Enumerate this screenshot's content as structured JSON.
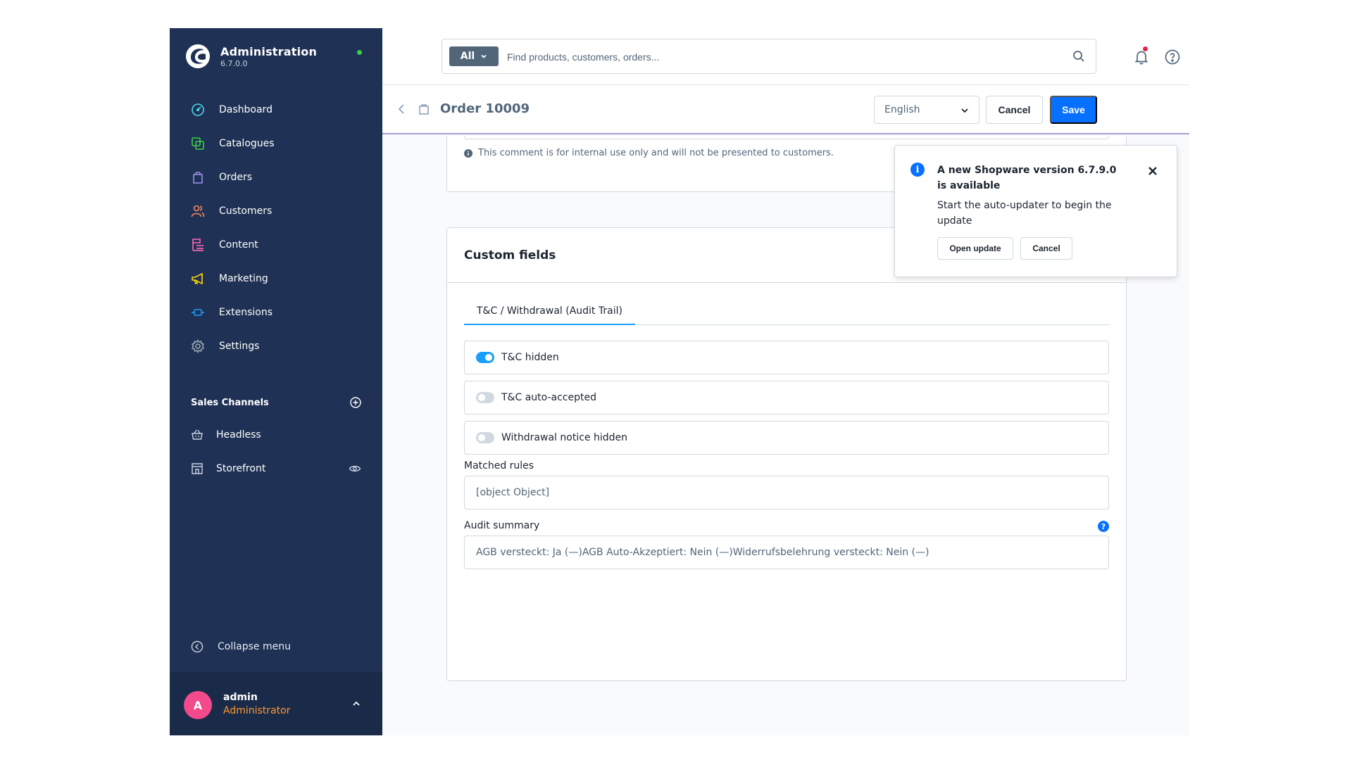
{
  "app": {
    "title": "Administration",
    "version": "6.7.0.0"
  },
  "colors": {
    "sidebar": "#1f3154",
    "primary": "#0870ff",
    "accent": "#189eff",
    "role": "#ff9a2f",
    "status_online": "#37d046"
  },
  "sidebar": {
    "items": [
      {
        "label": "Dashboard",
        "icon": "dashboard-icon",
        "color": "#4ed8e8"
      },
      {
        "label": "Catalogues",
        "icon": "catalogue-icon",
        "color": "#37d046"
      },
      {
        "label": "Orders",
        "icon": "orders-icon",
        "color": "#a092f0"
      },
      {
        "label": "Customers",
        "icon": "customers-icon",
        "color": "#f88962"
      },
      {
        "label": "Content",
        "icon": "content-icon",
        "color": "#ff68b4"
      },
      {
        "label": "Marketing",
        "icon": "marketing-icon",
        "color": "#ffd700"
      },
      {
        "label": "Extensions",
        "icon": "extensions-icon",
        "color": "#189eff"
      },
      {
        "label": "Settings",
        "icon": "settings-icon",
        "color": "#9aa8b5"
      }
    ],
    "sales_channels_title": "Sales Channels",
    "sales_channels": [
      {
        "label": "Headless",
        "icon": "basket-icon"
      },
      {
        "label": "Storefront",
        "icon": "storefront-icon"
      }
    ],
    "collapse_label": "Collapse menu",
    "user": {
      "initial": "A",
      "name": "admin",
      "role": "Administrator"
    }
  },
  "topbar": {
    "search_type": "All",
    "search_placeholder": "Find products, customers, orders..."
  },
  "smartbar": {
    "title": "Order 10009",
    "language": "English",
    "cancel_label": "Cancel",
    "save_label": "Save"
  },
  "content": {
    "comment_hint": "This comment is for internal use only and will not be presented to customers.",
    "custom_fields": {
      "title": "Custom fields",
      "tab_label": "T&C / Withdrawal (Audit Trail)",
      "toggles": [
        {
          "label": "T&C hidden",
          "on": true
        },
        {
          "label": "T&C auto-accepted",
          "on": false
        },
        {
          "label": "Withdrawal notice hidden",
          "on": false
        }
      ],
      "matched_rules_label": "Matched rules",
      "matched_rules_value": "[object Object]",
      "audit_summary_label": "Audit summary",
      "audit_summary_help": "?",
      "audit_summary_value": "AGB versteckt: Ja (—)AGB Auto-Akzeptiert: Nein (—)Widerrufsbelehrung versteckt: Nein (—)"
    }
  },
  "notification": {
    "icon_glyph": "i",
    "title": "A new Shopware version 6.7.9.0 is available",
    "text": "Start the auto-updater to begin the update",
    "open_label": "Open update",
    "cancel_label": "Cancel"
  }
}
